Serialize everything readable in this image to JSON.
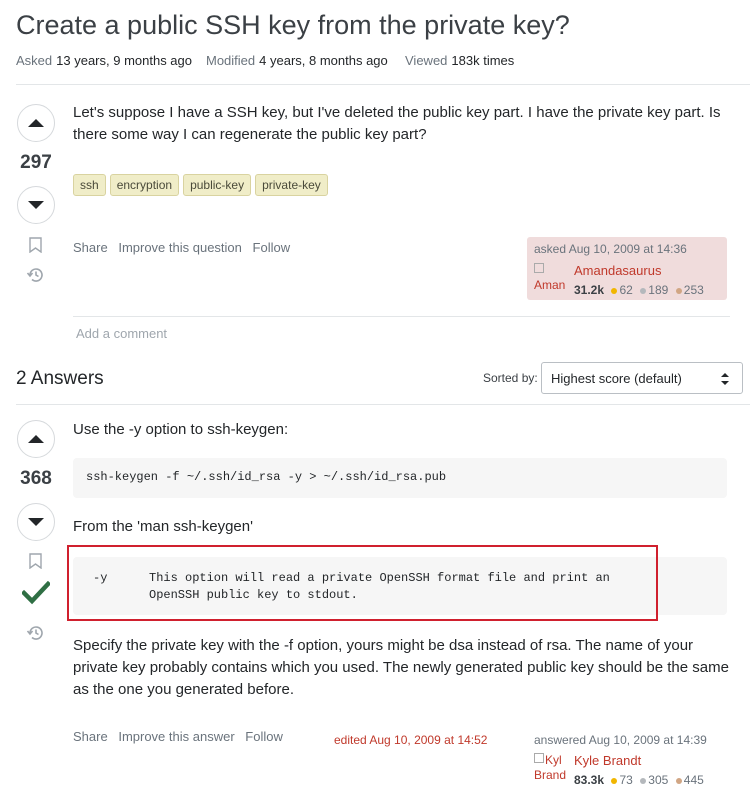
{
  "question": {
    "title": "Create a public SSH key from the private key?",
    "meta": {
      "asked_label": "Asked",
      "asked_value": "13 years, 9 months ago",
      "modified_label": "Modified",
      "modified_value": "4 years, 8 months ago",
      "viewed_label": "Viewed",
      "viewed_value": "183k times"
    },
    "score": "297",
    "body": "Let's suppose I have a SSH key, but I've deleted the public key part. I have the private key part. Is there some way I can regenerate the public key part?",
    "tags": [
      "ssh",
      "encryption",
      "public-key",
      "private-key"
    ],
    "menu": {
      "share": "Share",
      "improve": "Improve this question",
      "follow": "Follow"
    },
    "author": {
      "time": "asked Aug 10, 2009 at 14:36",
      "avatar_alt": "Aman",
      "name": "Amandasaurus",
      "reputation": "31.2k",
      "gold": "62",
      "silver": "189",
      "bronze": "253"
    },
    "add_comment": "Add a comment"
  },
  "answers_header": {
    "count_label": "2 Answers",
    "sorted_by_label": "Sorted by:",
    "sort_value": "Highest score (default)"
  },
  "answer": {
    "score": "368",
    "intro": "Use the -y option to ssh-keygen:",
    "code1": "ssh-keygen -f ~/.ssh/id_rsa -y > ~/.ssh/id_rsa.pub",
    "from_man": "From the 'man ssh-keygen'",
    "code2_flag": "-y",
    "code2_line1": "This option will read a private OpenSSH format file and print an",
    "code2_line2": "OpenSSH public key to stdout.",
    "body": "Specify the private key with the -f option, yours might be dsa instead of rsa. The name of your private key probably contains which you used. The newly generated public key should be the same as the one you generated before.",
    "menu": {
      "share": "Share",
      "improve": "Improve this answer",
      "follow": "Follow"
    },
    "edited": "edited Aug 10, 2009 at 14:52",
    "author": {
      "time": "answered Aug 10, 2009 at 14:39",
      "avatar_alt_1": "Kyl",
      "avatar_alt_2": "Brand",
      "name": "Kyle Brandt",
      "reputation": "83.3k",
      "gold": "73",
      "silver": "305",
      "bronze": "445"
    }
  },
  "colors": {
    "gold": "#f1b600",
    "silver": "#b4b8bc",
    "bronze": "#d1a684",
    "accepted": "#2f6f44",
    "highlight_border": "#d0202e"
  }
}
